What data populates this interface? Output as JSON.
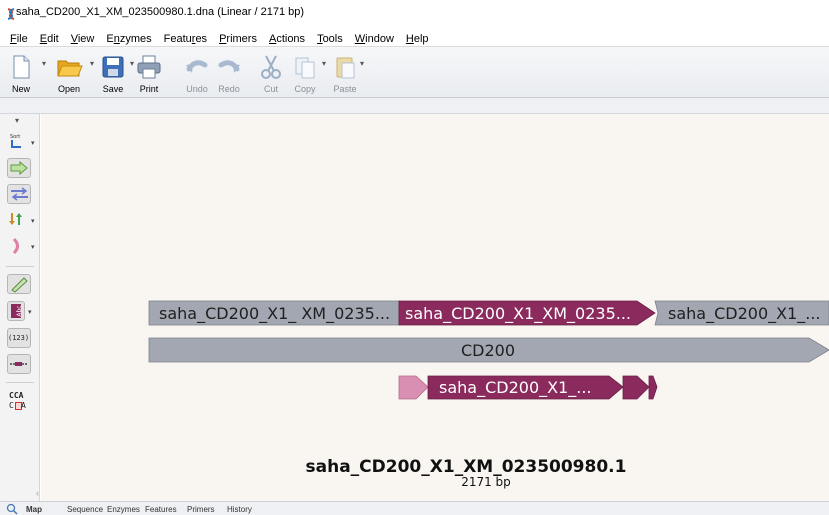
{
  "window": {
    "title": "saha_CD200_X1_XM_023500980.1.dna  (Linear / 2171 bp)"
  },
  "menu": [
    {
      "pre": "",
      "acc": "F",
      "post": "ile"
    },
    {
      "pre": "",
      "acc": "E",
      "post": "dit"
    },
    {
      "pre": "",
      "acc": "V",
      "post": "iew"
    },
    {
      "pre": "E",
      "acc": "n",
      "post": "zymes"
    },
    {
      "pre": "Featu",
      "acc": "r",
      "post": "es"
    },
    {
      "pre": "",
      "acc": "P",
      "post": "rimers"
    },
    {
      "pre": "",
      "acc": "A",
      "post": "ctions"
    },
    {
      "pre": "",
      "acc": "T",
      "post": "ools"
    },
    {
      "pre": "",
      "acc": "W",
      "post": "indow"
    },
    {
      "pre": "",
      "acc": "H",
      "post": "elp"
    }
  ],
  "toolbar": {
    "new": "New",
    "open": "Open",
    "save": "Save",
    "print": "Print",
    "undo": "Undo",
    "redo": "Redo",
    "cut": "Cut",
    "copy": "Copy",
    "paste": "Paste"
  },
  "left_tools": {
    "sort_label": "Sort",
    "number_label": "(123)",
    "codon_top": "CCA",
    "codon_bottom_left": "C",
    "codon_bottom_right": "A",
    "icons": [
      "sort-icon",
      "feature-arrow-icon",
      "strand-icon",
      "exchange-icon",
      "bracket-icon",
      "pencil-icon",
      "abc-icon",
      "number-icon",
      "ruler-icon",
      "codon-icon"
    ]
  },
  "map": {
    "features": {
      "row1_left": "saha_CD200_X1_ XM_0235...",
      "row1_mid": "saha_CD200_X1_XM_0235...",
      "row1_right": "saha_CD200_X1_...",
      "row2": "CD200",
      "row3": "saha_CD200_X1_..."
    },
    "sequence_name": "saha_CD200_X1_XM_023500980.1",
    "length": "2171 bp"
  },
  "bottom_tabs": [
    "Map",
    "Sequence",
    "Enzymes",
    "Features",
    "Primers",
    "History"
  ],
  "colors": {
    "gray_feature": "#a2a7b1",
    "magenta_feature": "#8b2a5c",
    "pink_feature": "#d88fb1",
    "canvas_bg": "#f9f6f2"
  }
}
